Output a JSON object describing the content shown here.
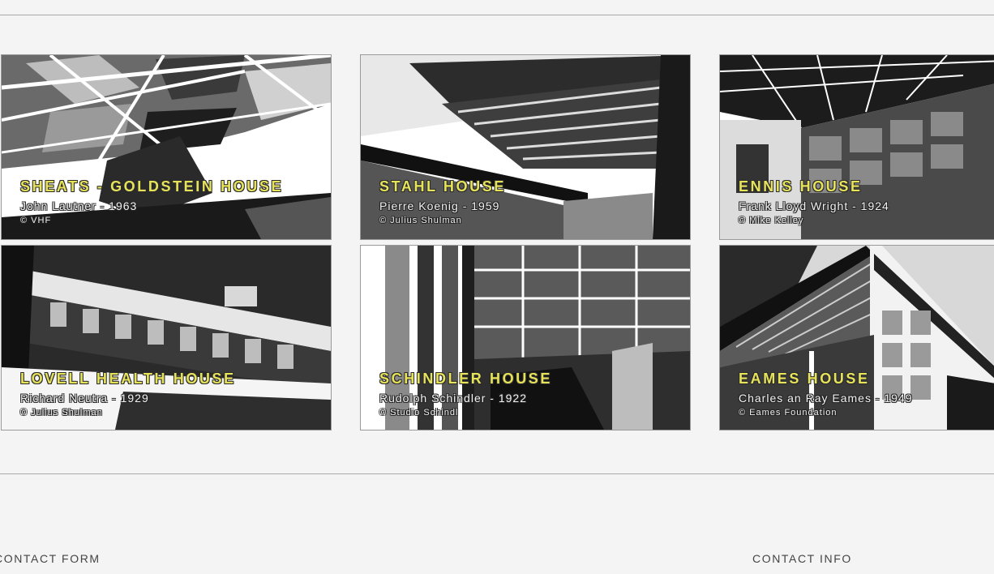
{
  "gallery": {
    "cards": [
      {
        "title": "SHEATS - GOLDSTEIN HOUSE",
        "subtitle": "John Lautner - 1963",
        "credit": "© VHF"
      },
      {
        "title": "STAHL HOUSE",
        "subtitle": "Pierre Koenig - 1959",
        "credit": "© Julius Shulman"
      },
      {
        "title": "ENNIS HOUSE",
        "subtitle": "Frank Lloyd Wright - 1924",
        "credit": "© Mike Kelley"
      },
      {
        "title": "LOVELL HEALTH HOUSE",
        "subtitle": "Richard Neutra - 1929",
        "credit": "© Julius Shulman"
      },
      {
        "title": "SCHINDLER HOUSE",
        "subtitle": "Rudolph Schindler - 1922",
        "credit": "© Studio Schindl"
      },
      {
        "title": "EAMES HOUSE",
        "subtitle": "Charles an Ray Eames - 1949",
        "credit": "© Eames Foundation"
      }
    ]
  },
  "footer": {
    "contact_form_label": "CONTACT FORM",
    "contact_info_label": "CONTACT INFO"
  },
  "colors": {
    "title": "#e6e35a",
    "background": "#f4f4f4",
    "rule": "#a8a8a8"
  }
}
